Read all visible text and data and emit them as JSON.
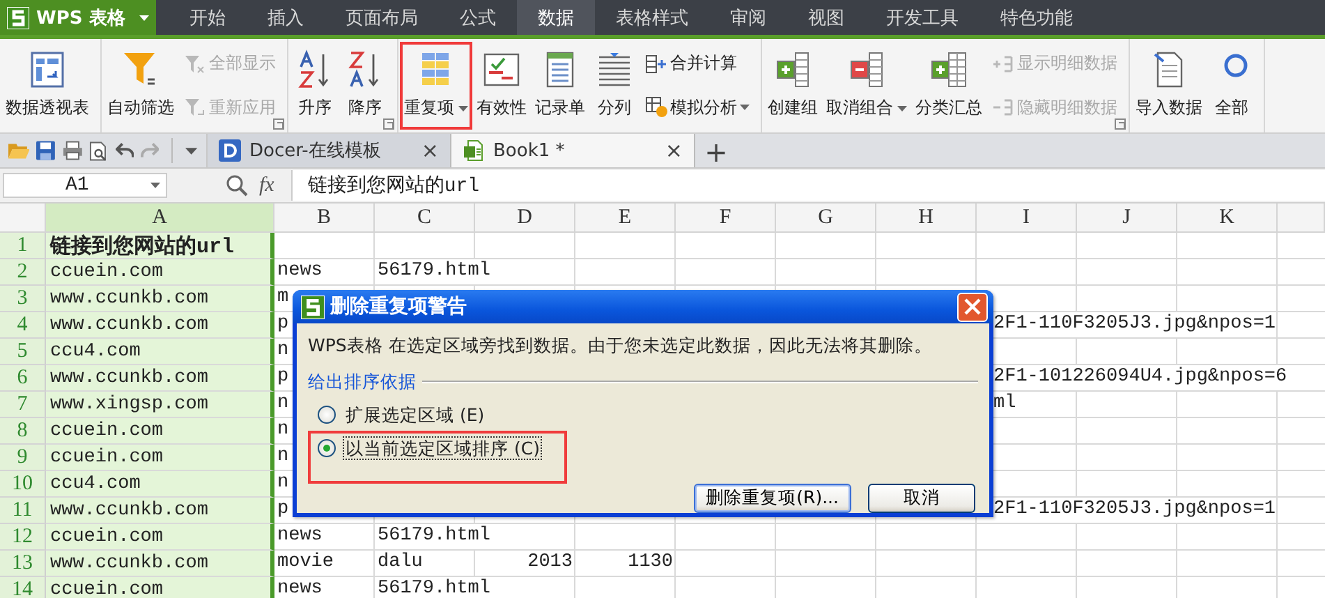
{
  "app_button": {
    "label": "WPS 表格"
  },
  "menu_tabs": [
    {
      "label": "开始",
      "selected": false
    },
    {
      "label": "插入",
      "selected": false
    },
    {
      "label": "页面布局",
      "selected": false
    },
    {
      "label": "公式",
      "selected": false
    },
    {
      "label": "数据",
      "selected": true
    },
    {
      "label": "表格样式",
      "selected": false
    },
    {
      "label": "审阅",
      "selected": false
    },
    {
      "label": "视图",
      "selected": false
    },
    {
      "label": "开发工具",
      "selected": false
    },
    {
      "label": "特色功能",
      "selected": false
    }
  ],
  "ribbon_groups": [
    {
      "launcher": false,
      "items": [
        {
          "kind": "large",
          "label": "数据透视表",
          "dropdown": false,
          "disabled": false,
          "highlighted": false
        }
      ]
    },
    {
      "launcher": true,
      "items": [
        {
          "kind": "large",
          "label": "自动筛选",
          "dropdown": false,
          "disabled": false,
          "highlighted": false
        },
        {
          "kind": "small",
          "label": "全部显示",
          "dropdown": false,
          "disabled": true,
          "highlighted": false
        },
        {
          "kind": "small",
          "label": "重新应用",
          "dropdown": false,
          "disabled": true,
          "highlighted": false
        }
      ]
    },
    {
      "launcher": true,
      "items": [
        {
          "kind": "large",
          "label": "升序",
          "dropdown": false,
          "disabled": false,
          "highlighted": false
        },
        {
          "kind": "large",
          "label": "降序",
          "dropdown": false,
          "disabled": false,
          "highlighted": false
        }
      ]
    },
    {
      "launcher": false,
      "items": [
        {
          "kind": "large",
          "label": "重复项",
          "dropdown": true,
          "disabled": false,
          "highlighted": true
        },
        {
          "kind": "large",
          "label": "有效性",
          "dropdown": false,
          "disabled": false,
          "highlighted": false
        },
        {
          "kind": "large",
          "label": "记录单",
          "dropdown": false,
          "disabled": false,
          "highlighted": false
        },
        {
          "kind": "large",
          "label": "分列",
          "dropdown": false,
          "disabled": false,
          "highlighted": false
        },
        {
          "kind": "small",
          "label": "合并计算",
          "dropdown": false,
          "disabled": false,
          "highlighted": false
        },
        {
          "kind": "small",
          "label": "模拟分析",
          "dropdown": true,
          "disabled": false,
          "highlighted": false
        }
      ]
    },
    {
      "launcher": true,
      "items": [
        {
          "kind": "large",
          "label": "创建组",
          "dropdown": false,
          "disabled": false,
          "highlighted": false
        },
        {
          "kind": "large",
          "label": "取消组合",
          "dropdown": true,
          "disabled": false,
          "highlighted": false
        },
        {
          "kind": "large",
          "label": "分类汇总",
          "dropdown": false,
          "disabled": false,
          "highlighted": false
        },
        {
          "kind": "small",
          "label": "显示明细数据",
          "dropdown": false,
          "disabled": true,
          "highlighted": false
        },
        {
          "kind": "small",
          "label": "隐藏明细数据",
          "dropdown": false,
          "disabled": true,
          "highlighted": false
        }
      ]
    },
    {
      "items": [
        {
          "kind": "large",
          "label": "导入数据",
          "dropdown": false,
          "disabled": false,
          "highlighted": false
        },
        {
          "kind": "large",
          "label": "全部",
          "dropdown": false,
          "disabled": false,
          "highlighted": false
        }
      ]
    }
  ],
  "doc_tabs": [
    {
      "label": "Docer-在线模板",
      "selected": false,
      "close": "×"
    },
    {
      "label": "Book1 *",
      "selected": true,
      "close": "×"
    }
  ],
  "new_tab": "+",
  "formula_bar": {
    "name_box": "A1",
    "fx": "fx",
    "content": "链接到您网站的url"
  },
  "sheet": {
    "columns": [
      {
        "label": "A",
        "selected": true
      },
      {
        "label": "B",
        "selected": false
      },
      {
        "label": "C",
        "selected": false
      },
      {
        "label": "D",
        "selected": false
      },
      {
        "label": "E",
        "selected": false
      },
      {
        "label": "F",
        "selected": false
      },
      {
        "label": "G",
        "selected": false
      },
      {
        "label": "H",
        "selected": false
      },
      {
        "label": "I",
        "selected": false
      },
      {
        "label": "J",
        "selected": false
      },
      {
        "label": "K",
        "selected": false
      }
    ],
    "rows": [
      {
        "header": "1",
        "cells": {
          "a": {
            "text": "链接到您网站的url",
            "kind": "title"
          }
        }
      },
      {
        "header": "2",
        "cells": {
          "a": {
            "text": "ccuein.com",
            "kind": "text"
          },
          "b": {
            "text": "news",
            "kind": "text"
          },
          "c": {
            "text": "56179.html",
            "kind": "text"
          }
        }
      },
      {
        "header": "3",
        "cells": {
          "a": {
            "text": "www.ccunkb.com",
            "kind": "text"
          },
          "b": {
            "text": "m",
            "kind": "text"
          }
        }
      },
      {
        "header": "4",
        "cells": {
          "a": {
            "text": "www.ccunkb.com",
            "kind": "text"
          },
          "b": {
            "text": "p",
            "kind": "text"
          },
          "i": {
            "text": "2F1-110F3205J3.jpg&npos=1",
            "kind": "clipped"
          }
        }
      },
      {
        "header": "5",
        "cells": {
          "a": {
            "text": "ccu4.com",
            "kind": "text"
          },
          "b": {
            "text": "n",
            "kind": "text"
          }
        }
      },
      {
        "header": "6",
        "cells": {
          "a": {
            "text": "www.ccunkb.com",
            "kind": "text"
          },
          "b": {
            "text": "p",
            "kind": "text"
          },
          "i": {
            "text": "2F1-101226094U4.jpg&npos=6",
            "kind": "clipped"
          }
        }
      },
      {
        "header": "7",
        "cells": {
          "a": {
            "text": "www.xingsp.com",
            "kind": "text"
          },
          "b": {
            "text": "n",
            "kind": "text"
          },
          "i": {
            "text": "ml",
            "kind": "clipped"
          }
        }
      },
      {
        "header": "8",
        "cells": {
          "a": {
            "text": "ccuein.com",
            "kind": "text"
          },
          "b": {
            "text": "n",
            "kind": "text"
          }
        }
      },
      {
        "header": "9",
        "cells": {
          "a": {
            "text": "ccuein.com",
            "kind": "text"
          },
          "b": {
            "text": "n",
            "kind": "text"
          }
        }
      },
      {
        "header": "10",
        "cells": {
          "a": {
            "text": "ccu4.com",
            "kind": "text"
          },
          "b": {
            "text": "n",
            "kind": "text"
          }
        }
      },
      {
        "header": "11",
        "cells": {
          "a": {
            "text": "www.ccunkb.com",
            "kind": "text"
          },
          "b": {
            "text": "p",
            "kind": "text"
          },
          "i": {
            "text": "2F1-110F3205J3.jpg&npos=1",
            "kind": "clipped"
          }
        }
      },
      {
        "header": "12",
        "cells": {
          "a": {
            "text": "ccuein.com",
            "kind": "text"
          },
          "b": {
            "text": "news",
            "kind": "text"
          },
          "c": {
            "text": "56179.html",
            "kind": "text"
          }
        }
      },
      {
        "header": "13",
        "cells": {
          "a": {
            "text": "www.ccunkb.com",
            "kind": "text"
          },
          "b": {
            "text": "movie",
            "kind": "text"
          },
          "c": {
            "text": "dalu",
            "kind": "text"
          },
          "d": {
            "text": "2013",
            "kind": "number"
          },
          "e": {
            "text": "1130",
            "kind": "number"
          }
        }
      },
      {
        "header": "14",
        "cells": {
          "a": {
            "text": "ccuein.com",
            "kind": "text"
          },
          "b": {
            "text": "news",
            "kind": "text"
          },
          "c": {
            "text": "56179.html",
            "kind": "text"
          }
        }
      }
    ]
  },
  "dialog": {
    "title": "删除重复项警告",
    "message": "WPS表格 在选定区域旁找到数据。由于您未选定此数据，因此无法将其删除。",
    "group_label": "给出排序依据",
    "options": [
      {
        "label": "扩展选定区域 (E)",
        "selected": false,
        "highlighted": false
      },
      {
        "label": "以当前选定区域排序 (C)",
        "selected": true,
        "highlighted": true
      }
    ],
    "buttons": [
      {
        "label": "删除重复项(R)...",
        "default": true
      },
      {
        "label": "取消",
        "default": false
      }
    ]
  }
}
